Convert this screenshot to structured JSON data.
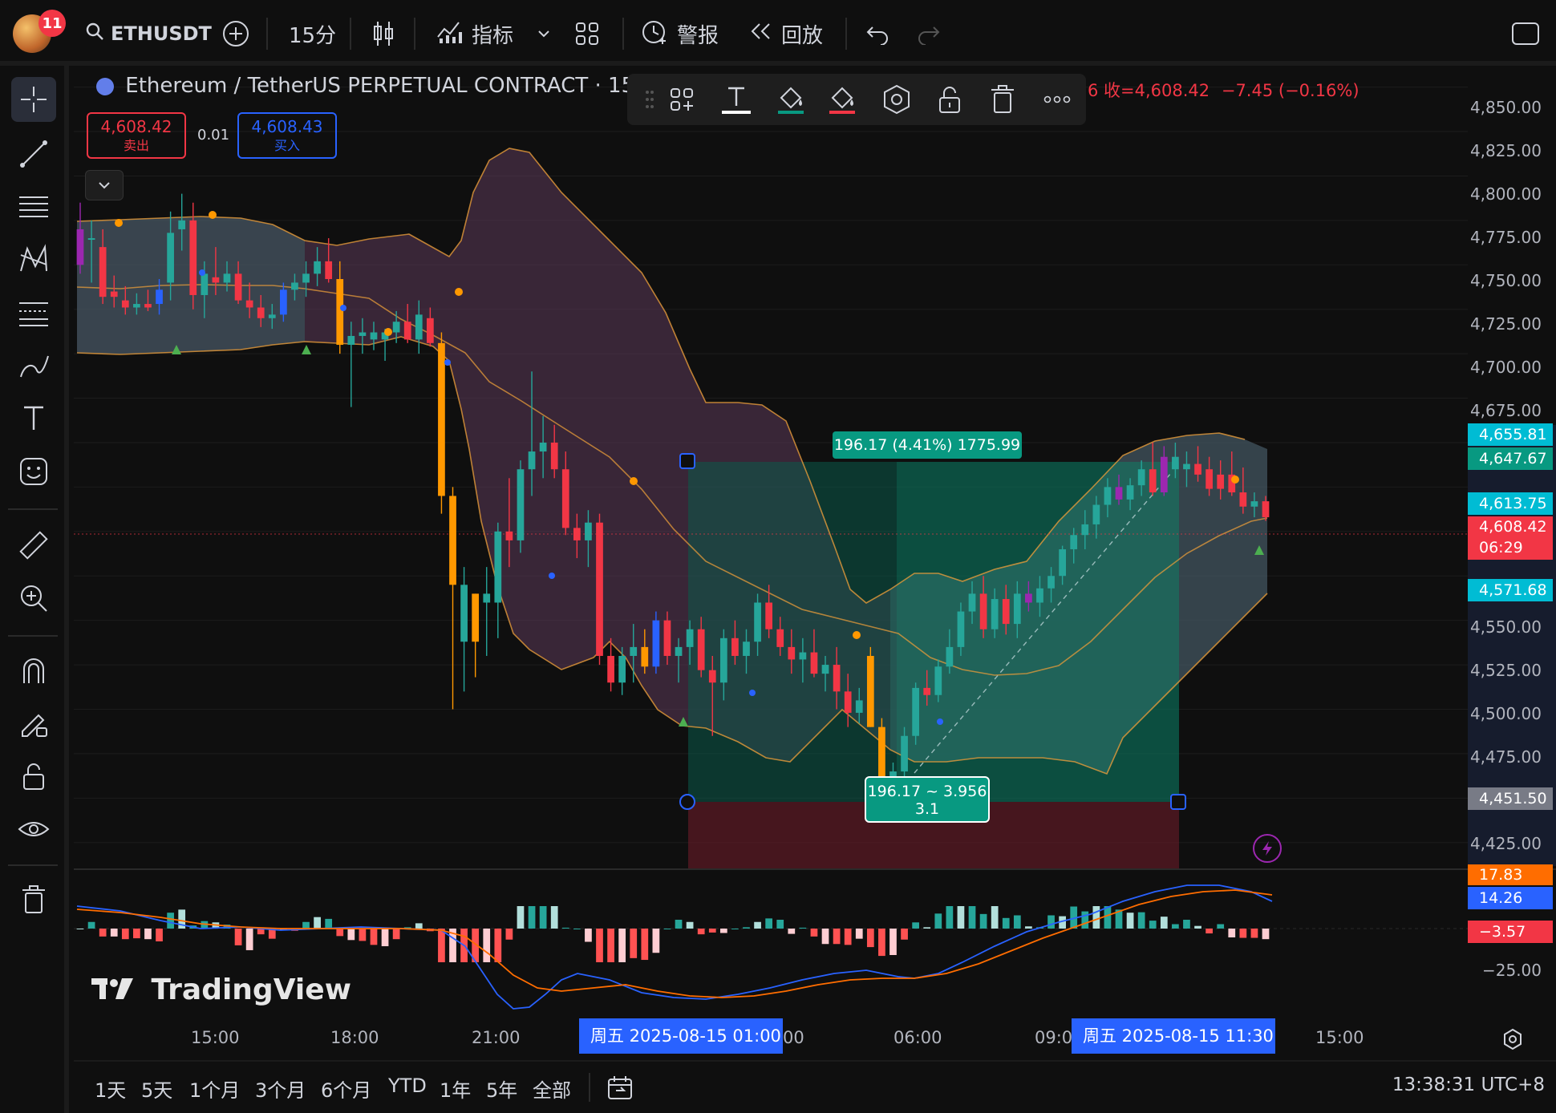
{
  "topbar": {
    "notification_count": "11",
    "symbol": "ETHUSDT",
    "interval": "15分",
    "indicators_label": "指标",
    "alert_label": "警报",
    "replay_label": "回放"
  },
  "legend": {
    "title": "Ethereum / TetherUS PERPETUAL CONTRACT · 15 ·",
    "ohlc_prefix": "6 收=",
    "close": "4,608.42",
    "change": "−7.45 (−0.16%)",
    "sell_price": "4,608.42",
    "sell_label": "卖出",
    "spread": "0.01",
    "buy_price": "4,608.43",
    "buy_label": "买入"
  },
  "price_axis": [
    "4,850.00",
    "4,825.00",
    "4,800.00",
    "4,775.00",
    "4,750.00",
    "4,725.00",
    "4,700.00",
    "4,675.00",
    "4,550.00",
    "4,525.00",
    "4,500.00",
    "4,475.00",
    "4,425.00"
  ],
  "price_tags": {
    "t1": "4,655.81",
    "t2": "4,647.67",
    "t3": "4,613.75",
    "t4": "4,608.42",
    "countdown": "06:29",
    "t5": "4,571.68",
    "t6": "4,451.50"
  },
  "indicator_axis": {
    "macd_tag": "17.83",
    "signal_tag": "14.26",
    "hist_tag": "−3.57",
    "level": "−25.00"
  },
  "risk_reward": {
    "top_label": "196.17 (4.41%) 1775.99",
    "bottom_line1": "196.17 ~ 3.956",
    "bottom_line2": "3.1"
  },
  "time_axis": {
    "labels": [
      "15:00",
      "18:00",
      "21:00",
      "00",
      "06:00",
      "09:0",
      "15:00"
    ],
    "highlight_start": "周五 2025-08-15   01:00",
    "highlight_end": "周五 2025-08-15   11:30"
  },
  "bottombar": {
    "ranges": [
      "1天",
      "5天",
      "1个月",
      "3个月",
      "6个月",
      "YTD",
      "1年",
      "5年",
      "全部"
    ],
    "clock": "13:38:31 UTC+8"
  },
  "brand": "TradingView",
  "colors": {
    "up": "#26a69a",
    "down": "#f23645",
    "accent": "#2962ff",
    "bb_fill": "#5d3a5a",
    "orange": "#ff9800"
  },
  "chart_data": {
    "type": "candlestick",
    "symbol": "ETHUSDT",
    "interval": "15",
    "ylim": [
      4410,
      4862
    ],
    "candles": [
      {
        "o": 4770,
        "h": 4785,
        "l": 4745,
        "c": 4750,
        "k": "m"
      },
      {
        "o": 4765,
        "h": 4775,
        "l": 4740,
        "c": 4765,
        "k": "u"
      },
      {
        "o": 4760,
        "h": 4770,
        "l": 4728,
        "c": 4732,
        "k": "d"
      },
      {
        "o": 4735,
        "h": 4744,
        "l": 4726,
        "c": 4732,
        "k": "d"
      },
      {
        "o": 4730,
        "h": 4738,
        "l": 4722,
        "c": 4726,
        "k": "d"
      },
      {
        "o": 4726,
        "h": 4734,
        "l": 4722,
        "c": 4728,
        "k": "u"
      },
      {
        "o": 4728,
        "h": 4736,
        "l": 4724,
        "c": 4726,
        "k": "d"
      },
      {
        "o": 4728,
        "h": 4742,
        "l": 4722,
        "c": 4736,
        "k": "b"
      },
      {
        "o": 4740,
        "h": 4780,
        "l": 4730,
        "c": 4768,
        "k": "u"
      },
      {
        "o": 4770,
        "h": 4790,
        "l": 4758,
        "c": 4775,
        "k": "u"
      },
      {
        "o": 4775,
        "h": 4785,
        "l": 4725,
        "c": 4733,
        "k": "d"
      },
      {
        "o": 4733,
        "h": 4752,
        "l": 4720,
        "c": 4745,
        "k": "u"
      },
      {
        "o": 4743,
        "h": 4760,
        "l": 4733,
        "c": 4740,
        "k": "d"
      },
      {
        "o": 4740,
        "h": 4752,
        "l": 4735,
        "c": 4745,
        "k": "u"
      },
      {
        "o": 4745,
        "h": 4752,
        "l": 4728,
        "c": 4730,
        "k": "d"
      },
      {
        "o": 4730,
        "h": 4740,
        "l": 4720,
        "c": 4726,
        "k": "d"
      },
      {
        "o": 4726,
        "h": 4733,
        "l": 4715,
        "c": 4720,
        "k": "d"
      },
      {
        "o": 4720,
        "h": 4728,
        "l": 4714,
        "c": 4722,
        "k": "u"
      },
      {
        "o": 4722,
        "h": 4740,
        "l": 4718,
        "c": 4736,
        "k": "b"
      },
      {
        "o": 4736,
        "h": 4745,
        "l": 4730,
        "c": 4740,
        "k": "u"
      },
      {
        "o": 4740,
        "h": 4752,
        "l": 4732,
        "c": 4745,
        "k": "u"
      },
      {
        "o": 4745,
        "h": 4760,
        "l": 4738,
        "c": 4752,
        "k": "u"
      },
      {
        "o": 4752,
        "h": 4765,
        "l": 4740,
        "c": 4742,
        "k": "d"
      },
      {
        "o": 4742,
        "h": 4752,
        "l": 4700,
        "c": 4705,
        "k": "o"
      },
      {
        "o": 4705,
        "h": 4718,
        "l": 4670,
        "c": 4710,
        "k": "u"
      },
      {
        "o": 4710,
        "h": 4720,
        "l": 4700,
        "c": 4712,
        "k": "u"
      },
      {
        "o": 4712,
        "h": 4718,
        "l": 4702,
        "c": 4708,
        "k": "u"
      },
      {
        "o": 4708,
        "h": 4714,
        "l": 4696,
        "c": 4712,
        "k": "u"
      },
      {
        "o": 4712,
        "h": 4724,
        "l": 4706,
        "c": 4718,
        "k": "u"
      },
      {
        "o": 4718,
        "h": 4728,
        "l": 4706,
        "c": 4708,
        "k": "d"
      },
      {
        "o": 4708,
        "h": 4730,
        "l": 4700,
        "c": 4722,
        "k": "u"
      },
      {
        "o": 4720,
        "h": 4726,
        "l": 4704,
        "c": 4706,
        "k": "d"
      },
      {
        "o": 4706,
        "h": 4712,
        "l": 4610,
        "c": 4620,
        "k": "o"
      },
      {
        "o": 4620,
        "h": 4625,
        "l": 4500,
        "c": 4570,
        "k": "o"
      },
      {
        "o": 4570,
        "h": 4580,
        "l": 4510,
        "c": 4538,
        "k": "u"
      },
      {
        "o": 4538,
        "h": 4565,
        "l": 4518,
        "c": 4565,
        "k": "o"
      },
      {
        "o": 4565,
        "h": 4580,
        "l": 4530,
        "c": 4560,
        "k": "u"
      },
      {
        "o": 4560,
        "h": 4605,
        "l": 4540,
        "c": 4600,
        "k": "u"
      },
      {
        "o": 4600,
        "h": 4630,
        "l": 4580,
        "c": 4595,
        "k": "d"
      },
      {
        "o": 4595,
        "h": 4640,
        "l": 4588,
        "c": 4635,
        "k": "u"
      },
      {
        "o": 4635,
        "h": 4690,
        "l": 4620,
        "c": 4645,
        "k": "u"
      },
      {
        "o": 4645,
        "h": 4665,
        "l": 4630,
        "c": 4650,
        "k": "u"
      },
      {
        "o": 4650,
        "h": 4660,
        "l": 4630,
        "c": 4635,
        "k": "d"
      },
      {
        "o": 4635,
        "h": 4645,
        "l": 4598,
        "c": 4602,
        "k": "d"
      },
      {
        "o": 4602,
        "h": 4610,
        "l": 4585,
        "c": 4595,
        "k": "d"
      },
      {
        "o": 4595,
        "h": 4612,
        "l": 4580,
        "c": 4605,
        "k": "u"
      },
      {
        "o": 4605,
        "h": 4610,
        "l": 4525,
        "c": 4530,
        "k": "d"
      },
      {
        "o": 4530,
        "h": 4540,
        "l": 4510,
        "c": 4515,
        "k": "d"
      },
      {
        "o": 4515,
        "h": 4535,
        "l": 4508,
        "c": 4530,
        "k": "u"
      },
      {
        "o": 4530,
        "h": 4548,
        "l": 4515,
        "c": 4535,
        "k": "u"
      },
      {
        "o": 4535,
        "h": 4545,
        "l": 4520,
        "c": 4524,
        "k": "o"
      },
      {
        "o": 4524,
        "h": 4555,
        "l": 4520,
        "c": 4550,
        "k": "b"
      },
      {
        "o": 4550,
        "h": 4555,
        "l": 4525,
        "c": 4530,
        "k": "d"
      },
      {
        "o": 4530,
        "h": 4540,
        "l": 4515,
        "c": 4535,
        "k": "u"
      },
      {
        "o": 4535,
        "h": 4550,
        "l": 4525,
        "c": 4545,
        "k": "u"
      },
      {
        "o": 4545,
        "h": 4552,
        "l": 4518,
        "c": 4522,
        "k": "d"
      },
      {
        "o": 4522,
        "h": 4530,
        "l": 4485,
        "c": 4515,
        "k": "d"
      },
      {
        "o": 4515,
        "h": 4545,
        "l": 4505,
        "c": 4540,
        "k": "u"
      },
      {
        "o": 4540,
        "h": 4550,
        "l": 4525,
        "c": 4530,
        "k": "d"
      },
      {
        "o": 4530,
        "h": 4545,
        "l": 4520,
        "c": 4538,
        "k": "u"
      },
      {
        "o": 4538,
        "h": 4565,
        "l": 4530,
        "c": 4560,
        "k": "u"
      },
      {
        "o": 4560,
        "h": 4570,
        "l": 4540,
        "c": 4545,
        "k": "d"
      },
      {
        "o": 4545,
        "h": 4552,
        "l": 4530,
        "c": 4535,
        "k": "d"
      },
      {
        "o": 4535,
        "h": 4545,
        "l": 4520,
        "c": 4528,
        "k": "d"
      },
      {
        "o": 4528,
        "h": 4540,
        "l": 4515,
        "c": 4532,
        "k": "u"
      },
      {
        "o": 4532,
        "h": 4545,
        "l": 4518,
        "c": 4520,
        "k": "d"
      },
      {
        "o": 4520,
        "h": 4530,
        "l": 4510,
        "c": 4525,
        "k": "u"
      },
      {
        "o": 4525,
        "h": 4535,
        "l": 4500,
        "c": 4510,
        "k": "d"
      },
      {
        "o": 4510,
        "h": 4520,
        "l": 4490,
        "c": 4498,
        "k": "d"
      },
      {
        "o": 4498,
        "h": 4512,
        "l": 4492,
        "c": 4505,
        "k": "u"
      },
      {
        "o": 4530,
        "h": 4535,
        "l": 4490,
        "c": 4490,
        "k": "o"
      },
      {
        "o": 4490,
        "h": 4495,
        "l": 4452,
        "c": 4458,
        "k": "o"
      },
      {
        "o": 4458,
        "h": 4470,
        "l": 4452,
        "c": 4465,
        "k": "u"
      },
      {
        "o": 4465,
        "h": 4490,
        "l": 4462,
        "c": 4485,
        "k": "u"
      },
      {
        "o": 4485,
        "h": 4515,
        "l": 4480,
        "c": 4512,
        "k": "u"
      },
      {
        "o": 4512,
        "h": 4522,
        "l": 4502,
        "c": 4508,
        "k": "d"
      },
      {
        "o": 4508,
        "h": 4528,
        "l": 4504,
        "c": 4524,
        "k": "u"
      },
      {
        "o": 4524,
        "h": 4545,
        "l": 4520,
        "c": 4535,
        "k": "u"
      },
      {
        "o": 4535,
        "h": 4560,
        "l": 4530,
        "c": 4555,
        "k": "u"
      },
      {
        "o": 4555,
        "h": 4572,
        "l": 4548,
        "c": 4565,
        "k": "u"
      },
      {
        "o": 4565,
        "h": 4575,
        "l": 4540,
        "c": 4545,
        "k": "d"
      },
      {
        "o": 4545,
        "h": 4568,
        "l": 4540,
        "c": 4562,
        "k": "u"
      },
      {
        "o": 4562,
        "h": 4570,
        "l": 4542,
        "c": 4548,
        "k": "d"
      },
      {
        "o": 4548,
        "h": 4572,
        "l": 4540,
        "c": 4565,
        "k": "u"
      },
      {
        "o": 4565,
        "h": 4572,
        "l": 4555,
        "c": 4560,
        "k": "m"
      },
      {
        "o": 4560,
        "h": 4575,
        "l": 4552,
        "c": 4568,
        "k": "u"
      },
      {
        "o": 4568,
        "h": 4580,
        "l": 4560,
        "c": 4575,
        "k": "u"
      },
      {
        "o": 4575,
        "h": 4592,
        "l": 4570,
        "c": 4590,
        "k": "u"
      },
      {
        "o": 4590,
        "h": 4602,
        "l": 4582,
        "c": 4598,
        "k": "u"
      },
      {
        "o": 4598,
        "h": 4612,
        "l": 4590,
        "c": 4604,
        "k": "u"
      },
      {
        "o": 4604,
        "h": 4620,
        "l": 4596,
        "c": 4615,
        "k": "u"
      },
      {
        "o": 4615,
        "h": 4630,
        "l": 4608,
        "c": 4625,
        "k": "u"
      },
      {
        "o": 4625,
        "h": 4632,
        "l": 4615,
        "c": 4618,
        "k": "m"
      },
      {
        "o": 4618,
        "h": 4630,
        "l": 4612,
        "c": 4626,
        "k": "u"
      },
      {
        "o": 4626,
        "h": 4640,
        "l": 4620,
        "c": 4635,
        "k": "u"
      },
      {
        "o": 4635,
        "h": 4650,
        "l": 4620,
        "c": 4622,
        "k": "d"
      },
      {
        "o": 4622,
        "h": 4648,
        "l": 4620,
        "c": 4642,
        "k": "m"
      },
      {
        "o": 4642,
        "h": 4650,
        "l": 4630,
        "c": 4635,
        "k": "u"
      },
      {
        "o": 4635,
        "h": 4645,
        "l": 4625,
        "c": 4638,
        "k": "u"
      },
      {
        "o": 4638,
        "h": 4648,
        "l": 4628,
        "c": 4632,
        "k": "d"
      },
      {
        "o": 4635,
        "h": 4642,
        "l": 4620,
        "c": 4624,
        "k": "d"
      },
      {
        "o": 4624,
        "h": 4640,
        "l": 4618,
        "c": 4632,
        "k": "d"
      },
      {
        "o": 4632,
        "h": 4645,
        "l": 4620,
        "c": 4622,
        "k": "d"
      },
      {
        "o": 4622,
        "h": 4636,
        "l": 4610,
        "c": 4614,
        "k": "d"
      },
      {
        "o": 4614,
        "h": 4622,
        "l": 4608,
        "c": 4617,
        "k": "u"
      },
      {
        "o": 4617,
        "h": 4620,
        "l": 4606,
        "c": 4608,
        "k": "d"
      }
    ]
  }
}
